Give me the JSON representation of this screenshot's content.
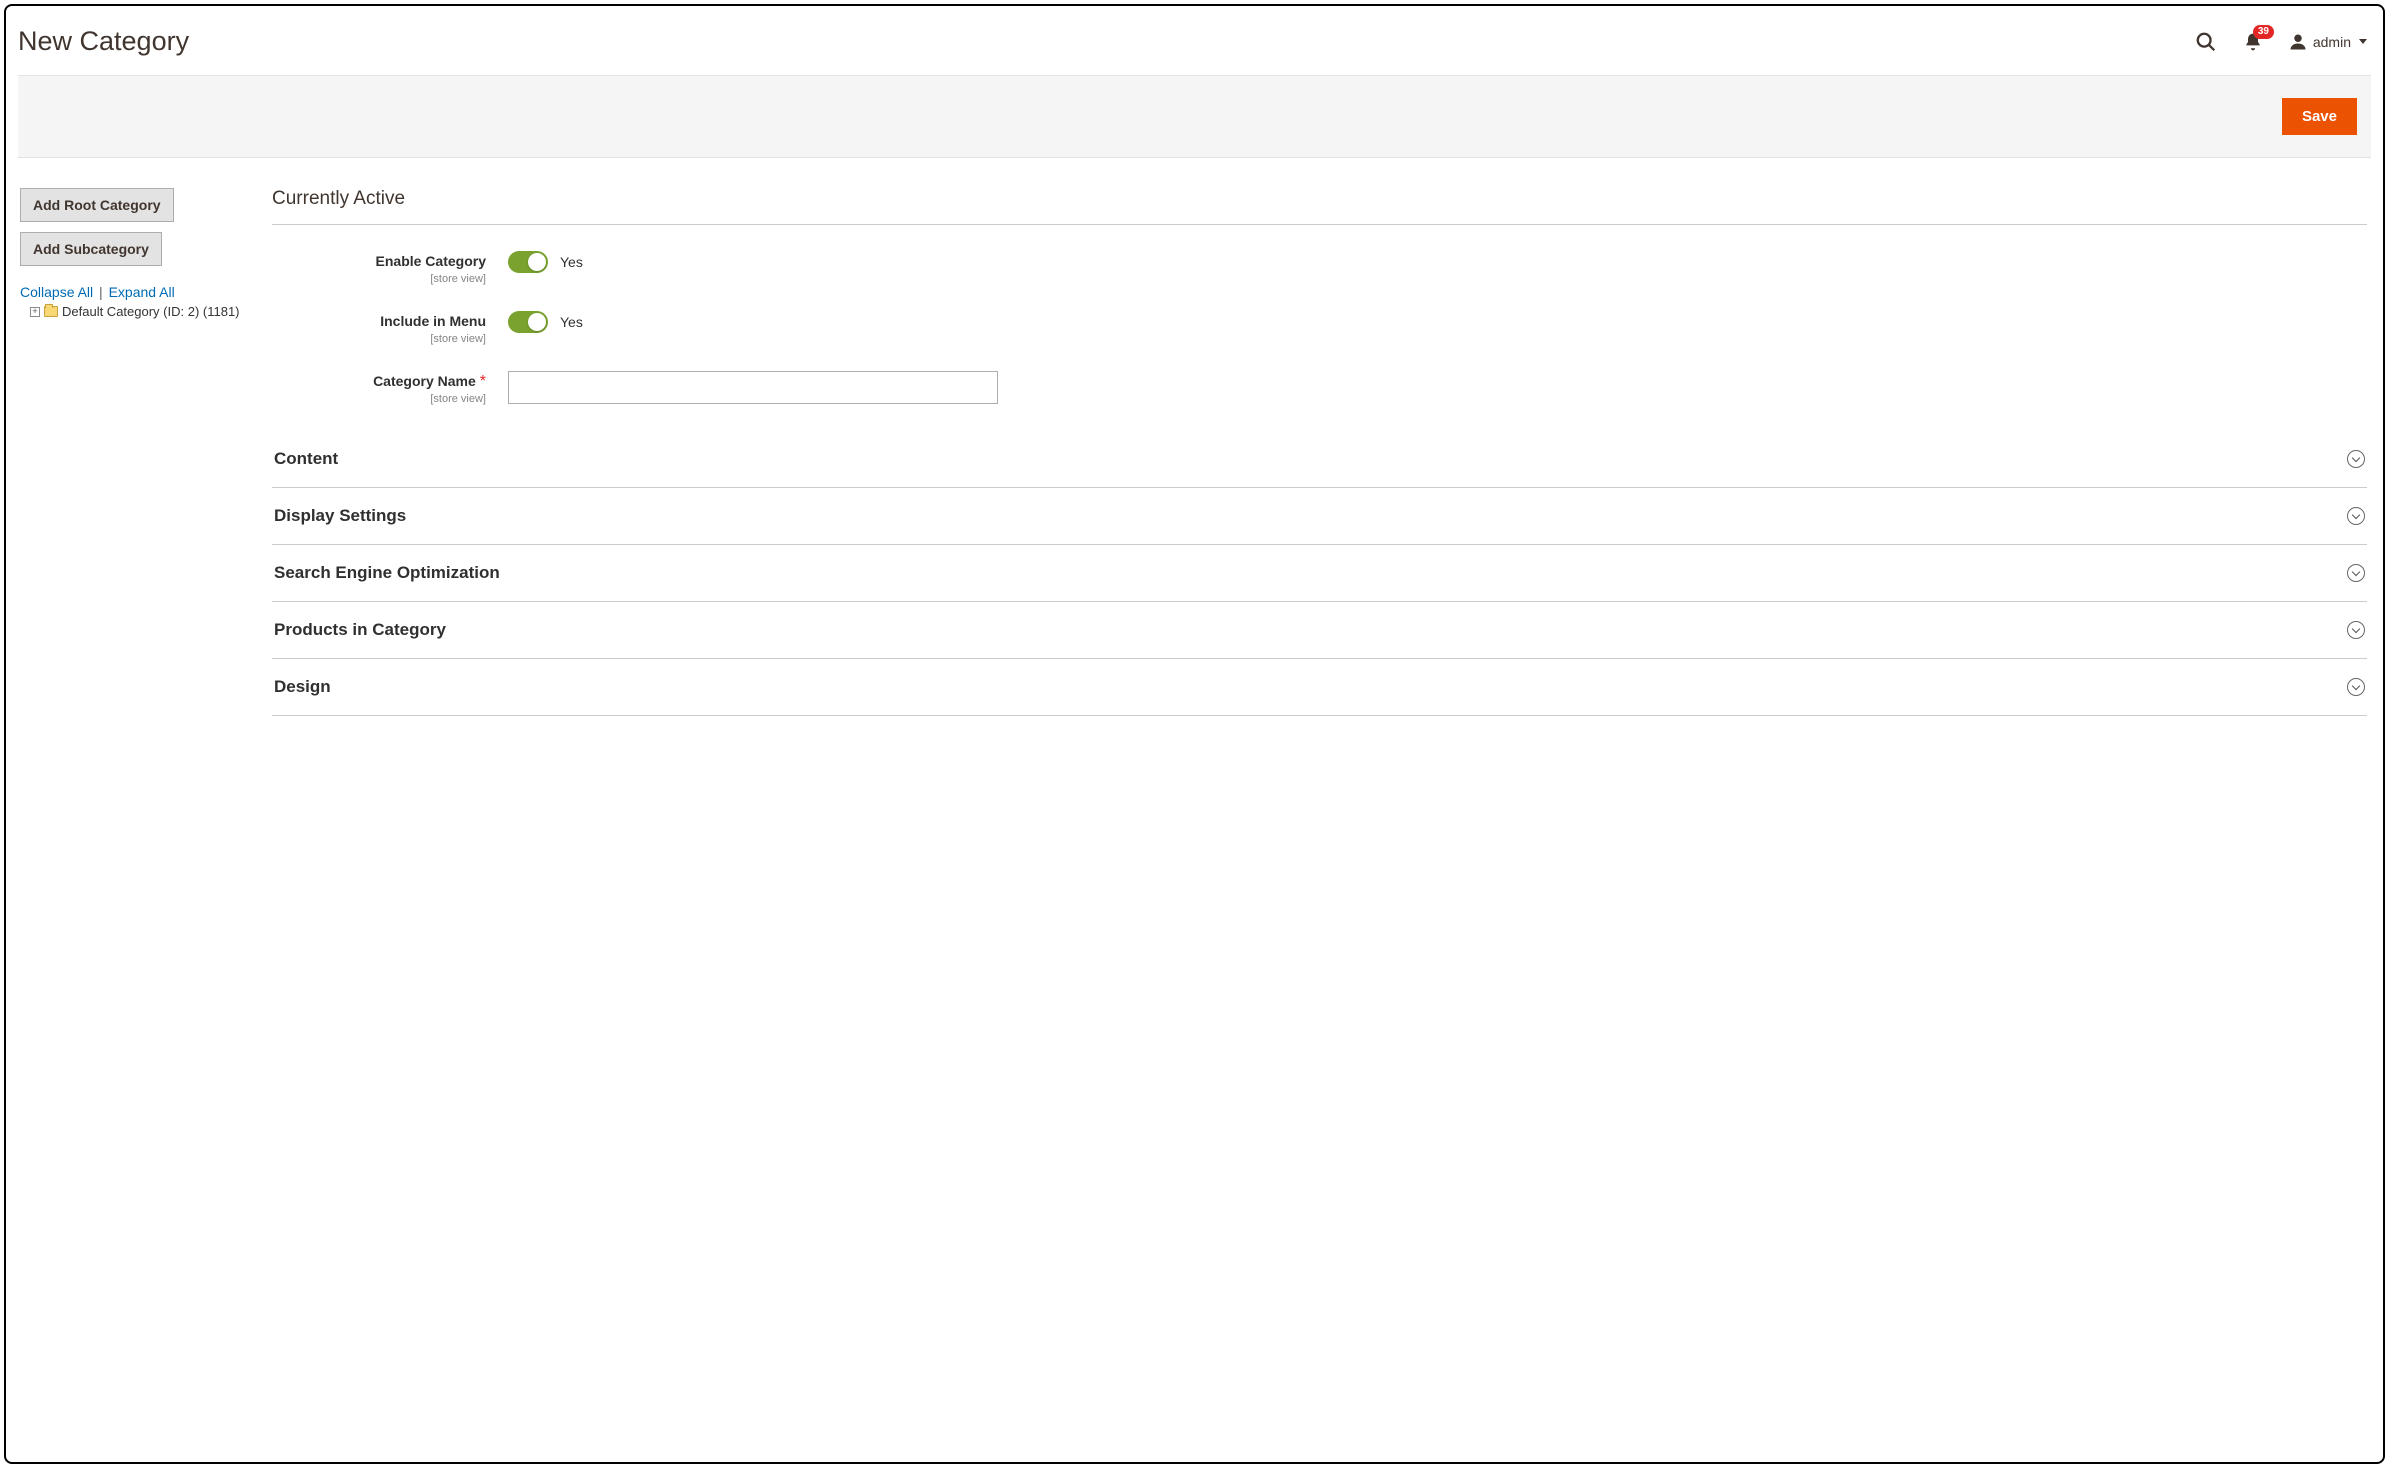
{
  "header": {
    "title": "New Category",
    "notification_count": "39",
    "user": "admin"
  },
  "toolbar": {
    "save_label": "Save"
  },
  "sidebar": {
    "add_root_label": "Add Root Category",
    "add_sub_label": "Add Subcategory",
    "collapse_label": "Collapse All",
    "expand_label": "Expand All",
    "tree_root_label": "Default Category (ID: 2) (1181)"
  },
  "form": {
    "section_title": "Currently Active",
    "scope_text": "[store view]",
    "fields": {
      "enable": {
        "label": "Enable Category",
        "value": "Yes"
      },
      "include_menu": {
        "label": "Include in Menu",
        "value": "Yes"
      },
      "name": {
        "label": "Category Name",
        "value": ""
      }
    }
  },
  "sections": [
    {
      "title": "Content"
    },
    {
      "title": "Display Settings"
    },
    {
      "title": "Search Engine Optimization"
    },
    {
      "title": "Products in Category"
    },
    {
      "title": "Design"
    }
  ]
}
